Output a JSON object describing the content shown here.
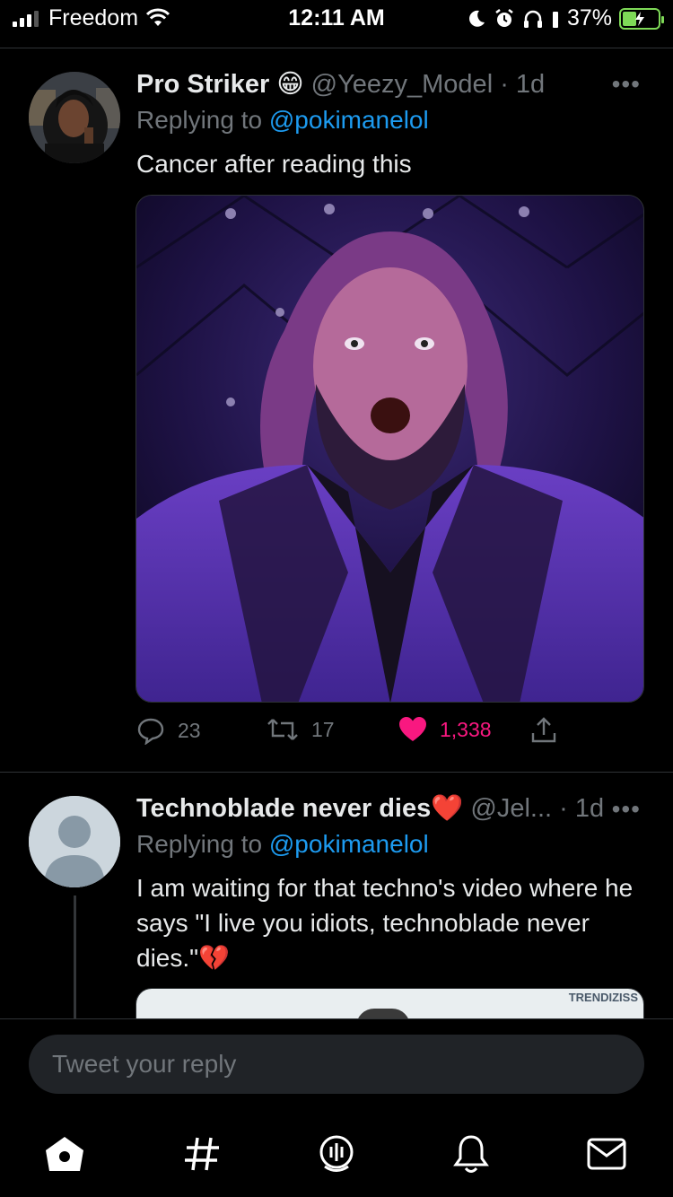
{
  "status_bar": {
    "carrier": "Freedom",
    "time": "12:11 AM",
    "battery": "37%"
  },
  "tweets": [
    {
      "name": "Pro Striker 😁",
      "handle": "@Yeezy_Model",
      "age": "· 1d",
      "replying_label": "Replying to",
      "replying_mention": "@pokimanelol",
      "text": "Cancer after reading this",
      "replies": "23",
      "retweets": "17",
      "likes": "1,338",
      "liked": true
    },
    {
      "name": "Technoblade never dies❤️",
      "handle": "@Jel...",
      "age": "· 1d",
      "replying_label": "Replying to",
      "replying_mention": "@pokimanelol",
      "text": "I am waiting for that techno's video where he says \"I live you idiots, technoblade never dies.\"💔",
      "media_watermark": "TRENDIZISS"
    }
  ],
  "composer": {
    "placeholder": "Tweet your reply"
  },
  "tabbar": {
    "tabs": [
      "home-icon",
      "explore-icon",
      "spaces-icon",
      "notifications-icon",
      "messages-icon"
    ]
  },
  "colors": {
    "accent": "#1d9bf0",
    "like": "#f91880",
    "muted": "#71767b",
    "background": "#000000"
  }
}
